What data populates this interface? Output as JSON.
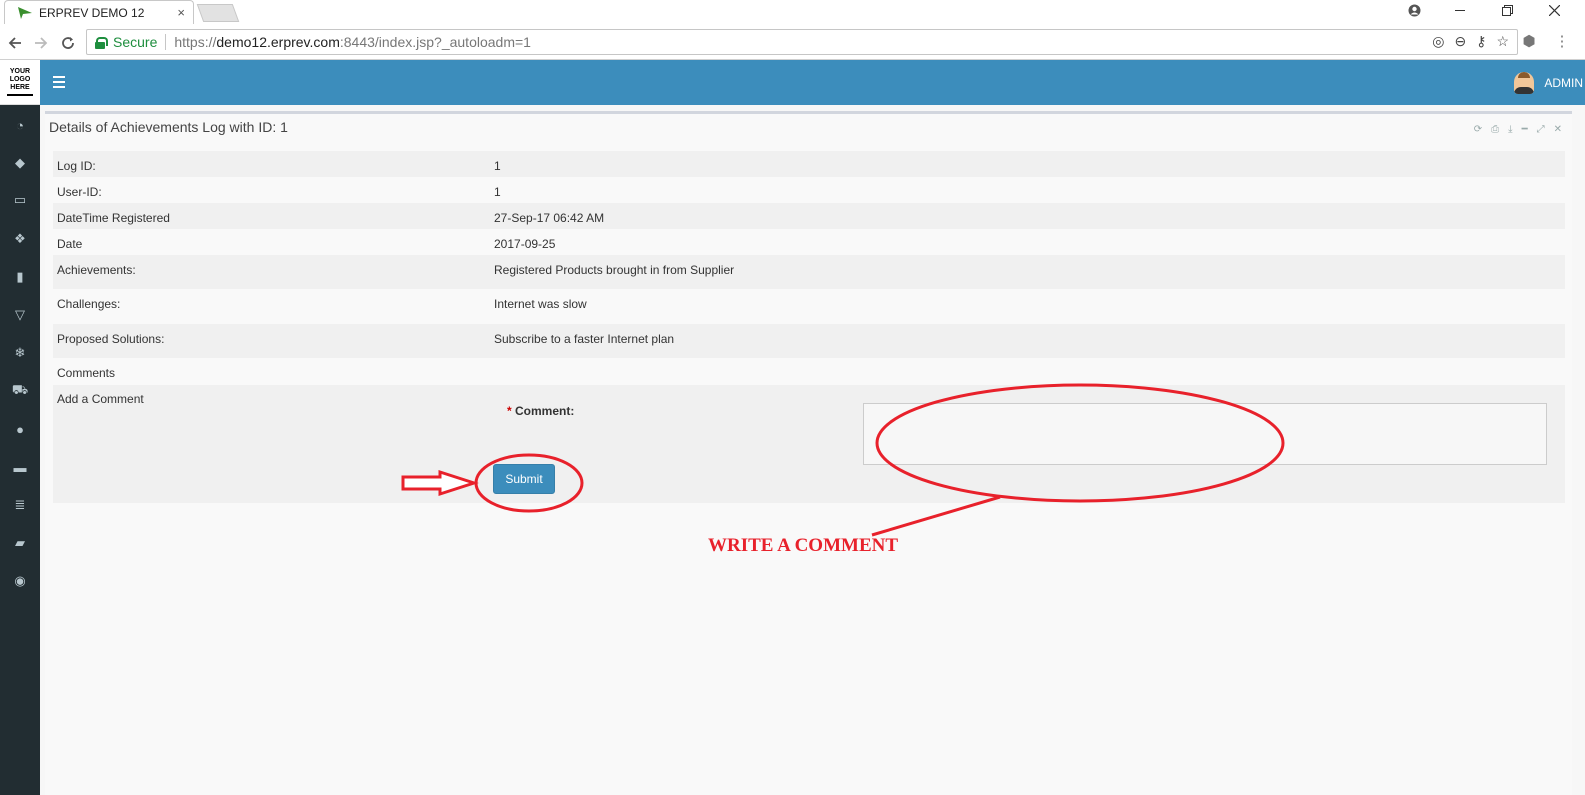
{
  "browser": {
    "tab_title": "ERPREV DEMO 12",
    "tab_close": "×",
    "secure_label": "Secure",
    "url_scheme": "https://",
    "url_host": "demo12.erprev.com",
    "url_rest": ":8443/index.jsp?_autoloadm=1"
  },
  "logo": {
    "line1": "YOUR",
    "line2": "LOGO",
    "line3": "HERE"
  },
  "header": {
    "user_label": "ADMIN"
  },
  "box": {
    "title": "Details of Achievements Log with ID: 1"
  },
  "details": [
    {
      "label": "Log ID:",
      "value": "1"
    },
    {
      "label": "User-ID:",
      "value": "1"
    },
    {
      "label": "DateTime Registered",
      "value": "27-Sep-17 06:42 AM"
    },
    {
      "label": "Date",
      "value": "2017-09-25"
    },
    {
      "label": "Achievements:",
      "value": "Registered Products brought  in from Supplier"
    },
    {
      "label": "Challenges:",
      "value": "Internet was slow"
    },
    {
      "label": "Proposed Solutions:",
      "value": "Subscribe to a faster Internet plan"
    },
    {
      "label": "Comments",
      "value": ""
    }
  ],
  "comment_form": {
    "section_label": "Add a Comment",
    "required_mark": "*",
    "field_label": "Comment:",
    "field_value": "",
    "submit_label": "Submit"
  },
  "annotation": {
    "text": "WRITE A COMMENT",
    "color": "#e8212b"
  },
  "colors": {
    "header": "#3c8dbc",
    "sidebar": "#222d32",
    "secure": "#1e8e3e"
  }
}
